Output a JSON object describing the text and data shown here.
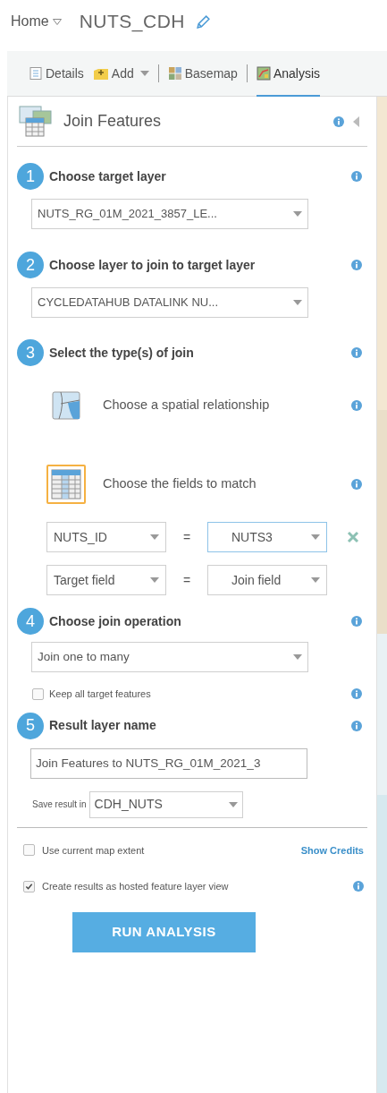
{
  "header": {
    "home": "Home",
    "title": "NUTS_CDH"
  },
  "toolbar": {
    "tabs": [
      {
        "label": "Details",
        "selected": false,
        "dropdown": false
      },
      {
        "label": "Add",
        "selected": false,
        "dropdown": true
      },
      {
        "label": "Basemap",
        "selected": false,
        "dropdown": false
      },
      {
        "label": "Analysis",
        "selected": true,
        "dropdown": false
      }
    ]
  },
  "panel": {
    "title": "Join Features",
    "steps": [
      {
        "number": "1",
        "label": "Choose target layer",
        "kind": "dropdown",
        "value": "NUTS_RG_01M_2021_3857_LE..."
      },
      {
        "number": "2",
        "label": "Choose layer to join to target layer",
        "kind": "dropdown",
        "value": "CYCLEDATAHUB DATALINK NU..."
      },
      {
        "number": "3",
        "label": "Select the type(s) of join",
        "kind": "join_types",
        "options": [
          {
            "label": "Choose a spatial relationship",
            "selected": false
          },
          {
            "label": "Choose the fields to match",
            "selected": true
          }
        ],
        "field_pairs": [
          {
            "target": "NUTS_ID",
            "operator": "=",
            "join": "NUTS3",
            "removable": true,
            "focused": true
          },
          {
            "target": "Target field",
            "operator": "=",
            "join": "Join field",
            "removable": false,
            "focused": false
          }
        ]
      },
      {
        "number": "4",
        "label": "Choose join operation",
        "kind": "dropdown_check",
        "value": "Join one to many",
        "checkbox": {
          "label": "Keep all target features",
          "checked": false
        }
      },
      {
        "number": "5",
        "label": "Result layer name",
        "kind": "text_input",
        "value": "Join Features to NUTS_RG_01M_2021_3",
        "save_in": {
          "label": "Save result in",
          "value": "CDH_NUTS"
        }
      }
    ],
    "footer_options": [
      {
        "label": "Use current map extent",
        "checked": false,
        "link": "Show Credits",
        "info": false
      },
      {
        "label": "Create results as hosted feature layer view",
        "checked": true,
        "info": true
      }
    ],
    "run_button": "RUN ANALYSIS"
  }
}
